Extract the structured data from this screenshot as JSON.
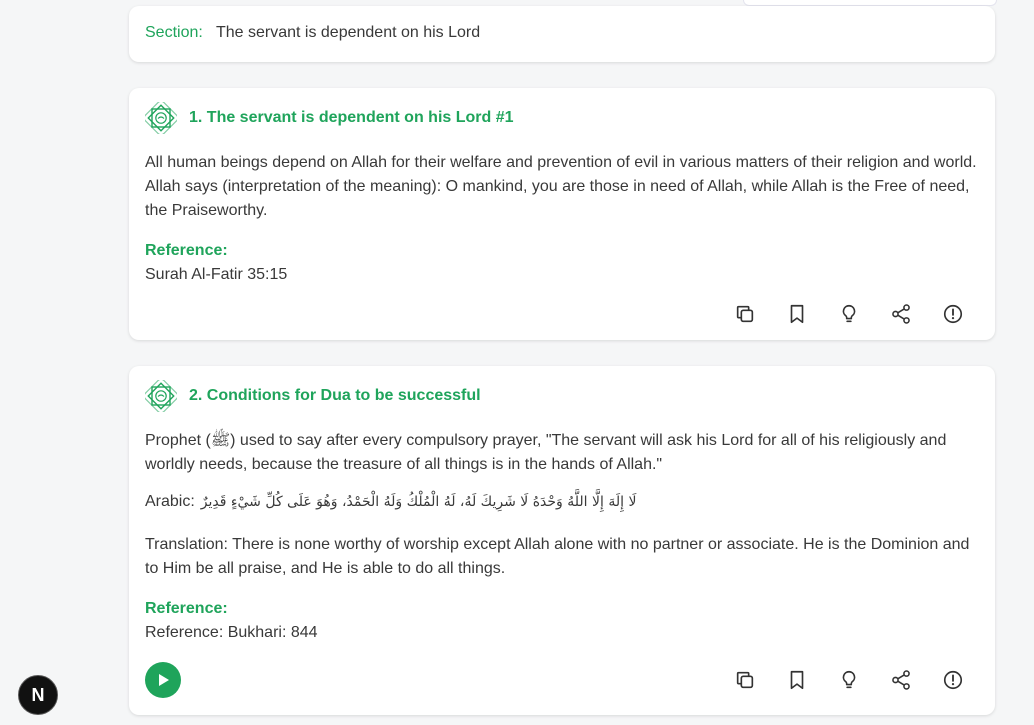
{
  "section": {
    "label": "Section:",
    "title": "The servant is dependent on his Lord"
  },
  "cards": [
    {
      "title": "1. The servant is dependent on his Lord #1",
      "body": "All human beings depend on Allah for their welfare and prevention of evil in various matters of their religion and world. Allah says (interpretation of the meaning): O mankind, you are those in need of Allah, while Allah is the Free of need, the Praiseworthy.",
      "reference_label": "Reference:",
      "reference": "Surah Al-Fatir 35:15"
    },
    {
      "title": "2. Conditions for Dua to be successful",
      "body": "Prophet (ﷺ) used to say after every compulsory prayer, \"The servant will ask his Lord for all of his religiously and worldly needs, because the treasure of all things is in the hands of Allah.\"",
      "arabic_label": "Arabic:",
      "arabic": "لَا إِلَهَ إِلَّا اللَّهُ وَحْدَهُ لَا شَرِيكَ لَهُ، لَهُ الْمُلْكُ وَلَهُ الْحَمْدُ، وَهُوَ عَلَى كُلِّ شَيْءٍ قَدِيرٌ",
      "translation": "Translation: There is none worthy of worship except Allah alone with no partner or associate. He is the Dominion and to Him be all praise, and He is able to do all things.",
      "reference_label": "Reference:",
      "reference": "Reference: Bukhari: 844"
    }
  ],
  "badge_text": "N",
  "icons": [
    "copy-icon",
    "bookmark-icon",
    "lightbulb-icon",
    "share-icon",
    "report-icon",
    "play-icon",
    "dua-badge-icon"
  ],
  "colors": {
    "accent": "#1fa45b",
    "text": "#393939",
    "background": "#f5f6f7"
  }
}
